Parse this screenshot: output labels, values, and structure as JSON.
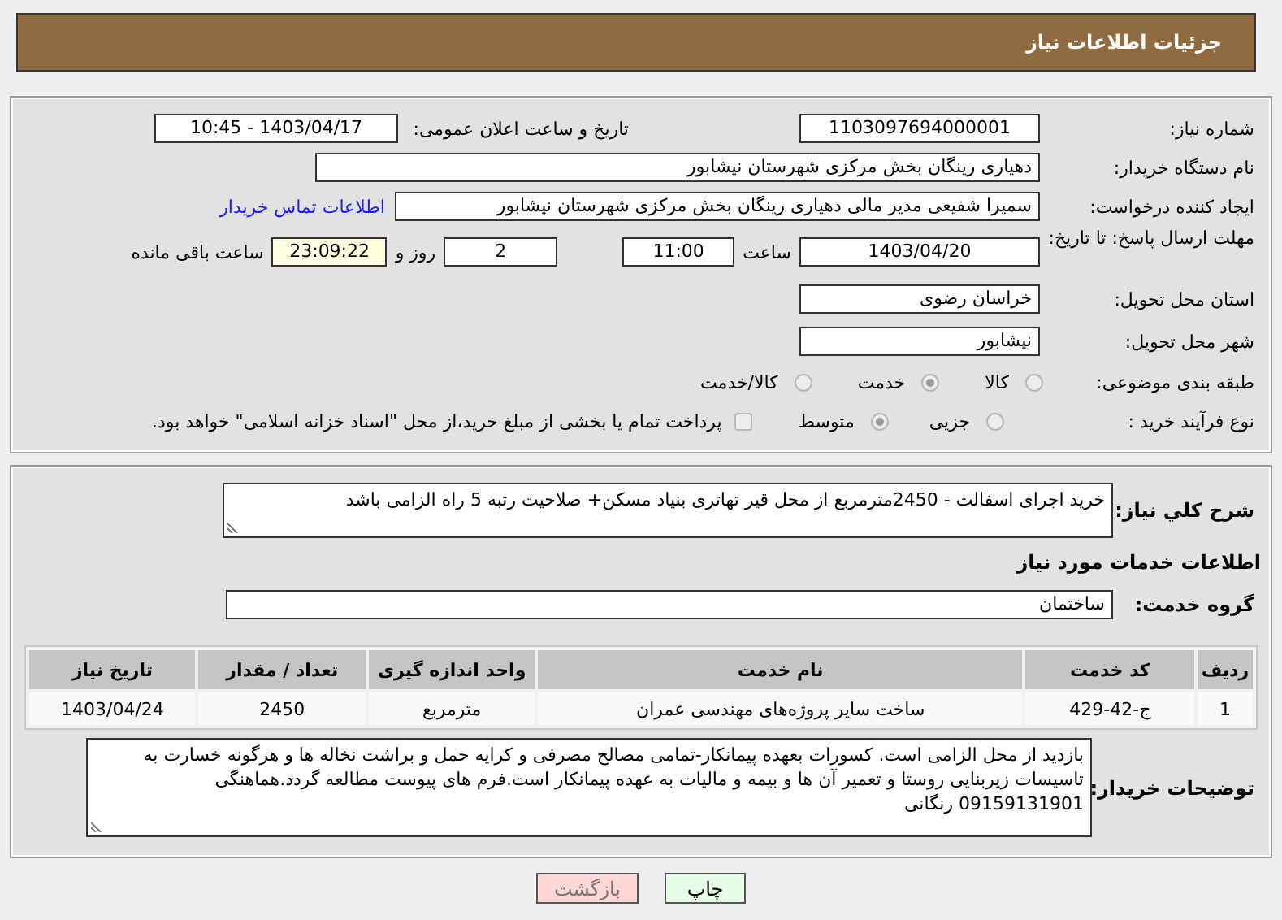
{
  "header": {
    "title": "جزئیات اطلاعات نیاز"
  },
  "details": {
    "need_number": {
      "label": "شماره نیاز:",
      "value": "1103097694000001"
    },
    "announce": {
      "label": "تاریخ و ساعت اعلان عمومی:",
      "value": "1403/04/17 - 10:45"
    },
    "buyer_org": {
      "label": "نام دستگاه خریدار:",
      "value": "دهیاری رینگان بخش مرکزی شهرستان نیشابور"
    },
    "creator": {
      "label": "ایجاد کننده درخواست:",
      "value": "سمیرا شفیعی مدیر مالی دهیاری رینگان بخش مرکزی شهرستان نیشابور",
      "link": "اطلاعات تماس خریدار"
    },
    "deadline": {
      "label": "مهلت ارسال پاسخ: تا تاریخ:",
      "date": "1403/04/20",
      "time_label": "ساعت",
      "time": "11:00",
      "days": "2",
      "days_label": "روز و",
      "remaining": "23:09:22",
      "remaining_label": "ساعت باقی مانده"
    },
    "province": {
      "label": "استان محل تحویل:",
      "value": "خراسان رضوی"
    },
    "city": {
      "label": "شهر محل تحویل:",
      "value": "نیشابور"
    },
    "category": {
      "label": "طبقه بندی موضوعی:",
      "options": [
        {
          "label": "کالا",
          "selected": false
        },
        {
          "label": "خدمت",
          "selected": true
        },
        {
          "label": "کالا/خدمت",
          "selected": false
        }
      ]
    },
    "process": {
      "label": "نوع فرآیند خرید :",
      "options": [
        {
          "label": "جزیی",
          "selected": false
        },
        {
          "label": "متوسط",
          "selected": true
        }
      ],
      "payment": {
        "label": "پرداخت تمام یا بخشی از مبلغ خرید،از محل \"اسناد خزانه اسلامی\" خواهد بود.",
        "checked": false
      }
    }
  },
  "services": {
    "summary": {
      "label": "شرح کلي نياز:",
      "value": "خرید اجرای اسفالت - 2450مترمربع از محل قیر تهاتری بنیاد مسکن+ صلاحیت رتبه 5 راه الزامی باشد"
    },
    "section_title": "اطلاعات خدمات مورد نیاز",
    "group": {
      "label": "گروه خدمت:",
      "value": "ساختمان"
    },
    "table": {
      "columns": [
        "ردیف",
        "کد خدمت",
        "نام خدمت",
        "واحد اندازه گیری",
        "تعداد / مقدار",
        "تاریخ نیاز"
      ],
      "rows": [
        [
          "1",
          "ج-42-429",
          "ساخت سایر پروژه‌های مهندسی عمران",
          "مترمربع",
          "2450",
          "1403/04/24"
        ]
      ]
    },
    "notes": {
      "label": "توضیحات خریدار:",
      "value": "بازدید از محل الزامی است.  کسورات بعهده پیمانکار-تمامی مصالح مصرفی و کرایه حمل و براشت نخاله ها و هرگونه خسارت به تاسیسات زیربنایی روستا و تعمیر آن ها و بیمه و مالیات به عهده پیمانکار است.فرم های پیوست مطالعه گردد.هماهنگی 09159131901 رنگانی"
    }
  },
  "buttons": [
    {
      "label": "چاپ",
      "kind": "print"
    },
    {
      "label": "بازگشت",
      "kind": "back"
    }
  ]
}
